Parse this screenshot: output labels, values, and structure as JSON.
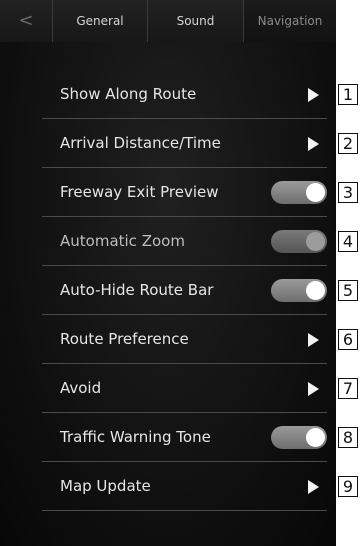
{
  "tabs": {
    "prev_arrow": "<",
    "next_arrow": ">",
    "items": [
      {
        "label": "General"
      },
      {
        "label": "Sound"
      },
      {
        "label": "Navigation"
      }
    ]
  },
  "settings": [
    {
      "label": "Show Along Route",
      "control": "submenu",
      "callout": "1"
    },
    {
      "label": "Arrival Distance/Time",
      "control": "submenu",
      "callout": "2"
    },
    {
      "label": "Freeway Exit Preview",
      "control": "toggle",
      "state": "on",
      "callout": "3"
    },
    {
      "label": "Automatic Zoom",
      "control": "toggle",
      "state": "on",
      "enabled": false,
      "callout": "4"
    },
    {
      "label": "Auto-Hide Route Bar",
      "control": "toggle",
      "state": "on",
      "callout": "5"
    },
    {
      "label": "Route Preference",
      "control": "submenu",
      "callout": "6"
    },
    {
      "label": "Avoid",
      "control": "submenu",
      "callout": "7"
    },
    {
      "label": "Traffic Warning Tone",
      "control": "toggle",
      "state": "on",
      "callout": "8"
    },
    {
      "label": "Map Update",
      "control": "submenu",
      "callout": "9"
    }
  ],
  "colors": {
    "background": "#121212",
    "text": "#e6e6e6",
    "toggle_track": "#8a8a8a",
    "divider": "#4b4b4b"
  }
}
